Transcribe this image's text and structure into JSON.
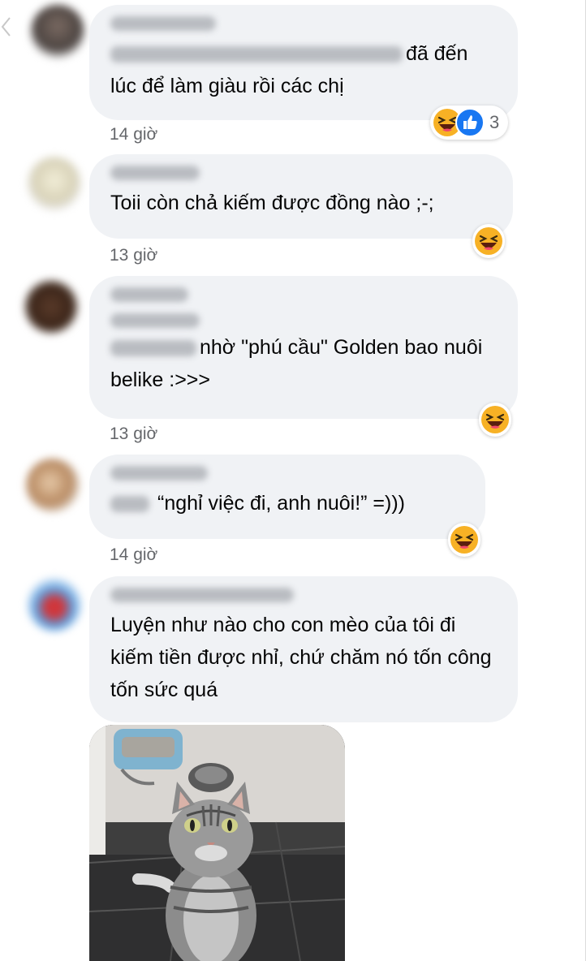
{
  "comments": [
    {
      "text": "đã đến lúc để làm giàu rồi các chị",
      "time": "14 giờ",
      "reaction_count": "3",
      "reactions": [
        "haha-icon",
        "like-icon"
      ]
    },
    {
      "text": "Toii còn chả kiếm được đồng nào ;-;",
      "time": "13 giờ",
      "reactions": [
        "haha-icon"
      ]
    },
    {
      "text": "nhờ \"phú cầu\" Golden bao nuôi belike :>>>",
      "time": "13 giờ",
      "reactions": [
        "haha-icon"
      ]
    },
    {
      "text": "“nghỉ việc đi, anh nuôi!” =)))",
      "time": "14 giờ",
      "reactions": [
        "haha-icon"
      ]
    },
    {
      "text": "Luyện như nào cho con mèo của tôi đi kiếm tiền được nhỉ, chứ chăm nó tốn công tốn sức quá",
      "time": "",
      "reactions": []
    }
  ],
  "colors": {
    "bubble": "#f0f2f5",
    "time": "#65676b",
    "like_blue": "#1877f2",
    "haha_yellow": "#f7b125"
  }
}
